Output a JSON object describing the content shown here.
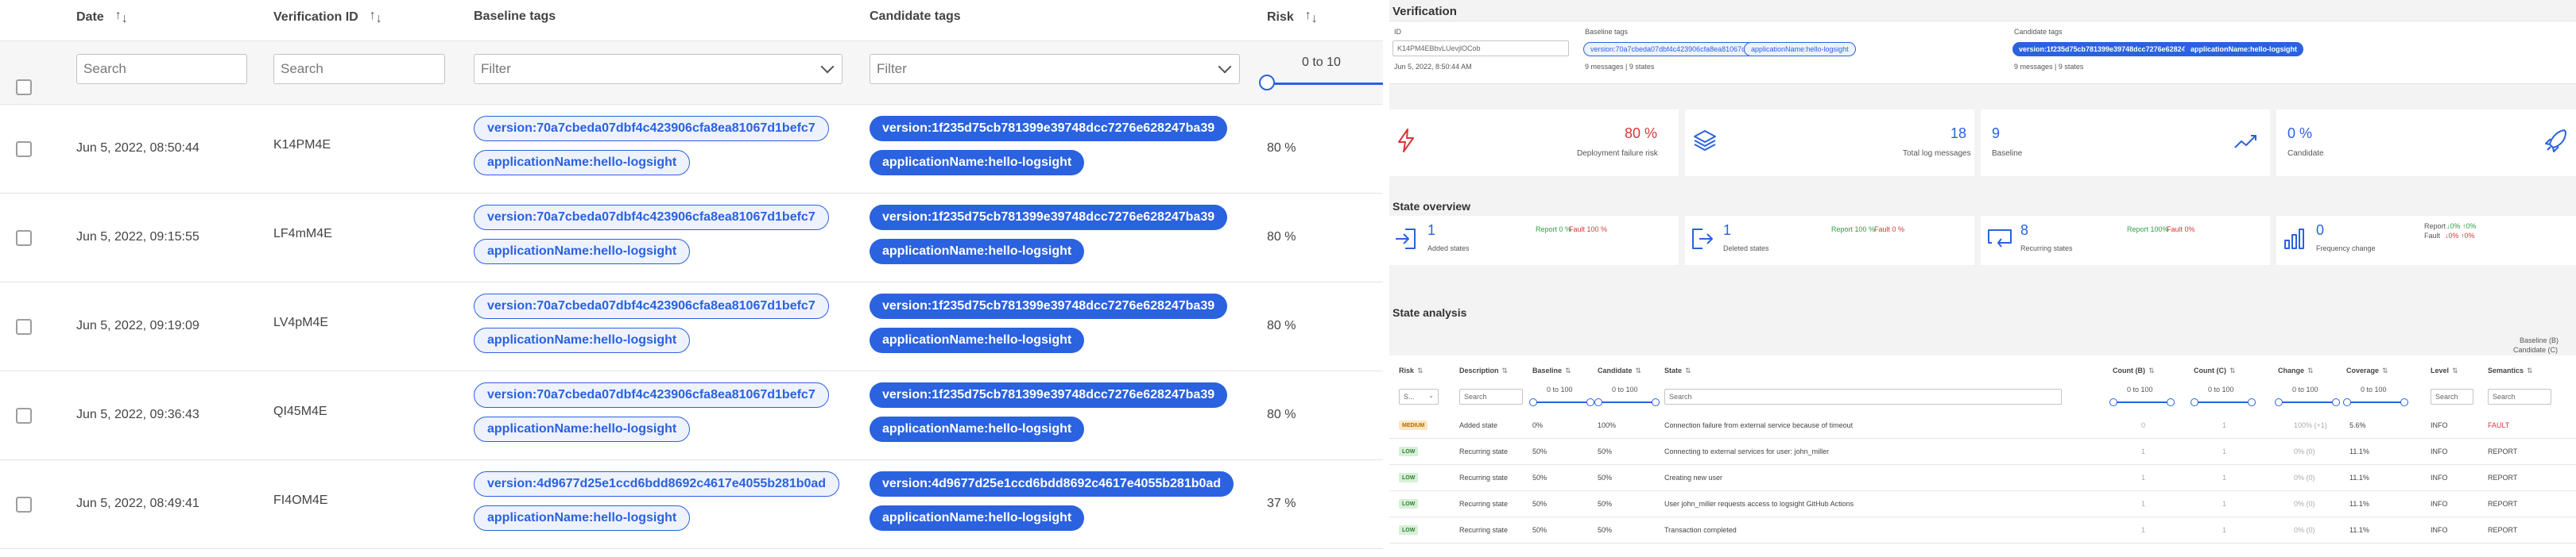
{
  "list": {
    "headers": {
      "date": "Date",
      "verification_id": "Verification ID",
      "baseline_tags": "Baseline tags",
      "candidate_tags": "Candidate tags",
      "risk": "Risk"
    },
    "filters": {
      "date_placeholder": "Search",
      "id_placeholder": "Search",
      "baseline_placeholder": "Filter",
      "candidate_placeholder": "Filter",
      "risk_range": "0 to 10"
    },
    "rows": [
      {
        "date": "Jun 5, 2022, 08:50:44",
        "id": "K14PM4E",
        "baseline": [
          "version:70a7cbeda07dbf4c423906cfa8ea81067d1befc7",
          "applicationName:hello-logsight"
        ],
        "candidate": [
          "version:1f235d75cb781399e39748dcc7276e628247ba39",
          "applicationName:hello-logsight"
        ],
        "risk": "80 %"
      },
      {
        "date": "Jun 5, 2022, 09:15:55",
        "id": "LF4mM4E",
        "baseline": [
          "version:70a7cbeda07dbf4c423906cfa8ea81067d1befc7",
          "applicationName:hello-logsight"
        ],
        "candidate": [
          "version:1f235d75cb781399e39748dcc7276e628247ba39",
          "applicationName:hello-logsight"
        ],
        "risk": "80 %"
      },
      {
        "date": "Jun 5, 2022, 09:19:09",
        "id": "LV4pM4E",
        "baseline": [
          "version:70a7cbeda07dbf4c423906cfa8ea81067d1befc7",
          "applicationName:hello-logsight"
        ],
        "candidate": [
          "version:1f235d75cb781399e39748dcc7276e628247ba39",
          "applicationName:hello-logsight"
        ],
        "risk": "80 %"
      },
      {
        "date": "Jun 5, 2022, 09:36:43",
        "id": "QI45M4E",
        "baseline": [
          "version:70a7cbeda07dbf4c423906cfa8ea81067d1befc7",
          "applicationName:hello-logsight"
        ],
        "candidate": [
          "version:1f235d75cb781399e39748dcc7276e628247ba39",
          "applicationName:hello-logsight"
        ],
        "risk": "80 %"
      },
      {
        "date": "Jun 5, 2022, 08:49:41",
        "id": "FI4OM4E",
        "baseline": [
          "version:4d9677d25e1ccd6bdd8692c4617e4055b281b0ad",
          "applicationName:hello-logsight"
        ],
        "candidate": [
          "version:4d9677d25e1ccd6bdd8692c4617e4055b281b0ad",
          "applicationName:hello-logsight"
        ],
        "risk": "37 %"
      }
    ]
  },
  "detail": {
    "title": "Verification",
    "id_label": "ID",
    "id_value": "K14PM4EBbvLUevjlOCob",
    "timestamp": "Jun 5, 2022, 8:50:44 AM",
    "baseline_tags_label": "Baseline tags",
    "baseline_tags": [
      "version:70a7cbeda07dbf4c423906cfa8ea81067d1befc7",
      "applicationName:hello-logsight"
    ],
    "baseline_counts": "9 messages  |  9 states",
    "candidate_tags_label": "Candidate tags",
    "candidate_tags": [
      "version:1f235d75cb781399e39748dcc7276e628247ba39",
      "applicationName:hello-logsight"
    ],
    "candidate_counts": "9 messages  |  9 states",
    "kpis": {
      "risk_value": "80 %",
      "risk_label": "Deployment failure risk",
      "logs_value": "18",
      "logs_label": "Total log messages",
      "baseline_value": "9",
      "baseline_label": "Baseline",
      "candidate_value": "0 %",
      "candidate_label": "Candidate"
    },
    "state_overview": {
      "title": "State overview",
      "added_value": "1",
      "added_label": "Added states",
      "added_report": "Report 0 %",
      "added_fault": "Fault 100 %",
      "deleted_value": "1",
      "deleted_label": "Deleted states",
      "deleted_report": "Report 100 %",
      "deleted_fault": "Fault 0 %",
      "recurring_value": "8",
      "recurring_label": "Recurring states",
      "recurring_report": "Report 100%",
      "recurring_fault": "Fault 0%",
      "freq_value": "0",
      "freq_label": "Frequency change",
      "freq_report": "Report",
      "freq_report_vals": "↓0%  ↑0%",
      "freq_fault": "Fault",
      "freq_fault_vals": "↓0%  ↑0%"
    },
    "analysis": {
      "title": "State analysis",
      "legend_b": "Baseline (B)",
      "legend_c": "Candidate (C)",
      "headers": {
        "risk": "Risk",
        "description": "Description",
        "baseline": "Baseline",
        "candidate": "Candidate",
        "state": "State",
        "count_b": "Count (B)",
        "count_c": "Count (C)",
        "change": "Change",
        "coverage": "Coverage",
        "level": "Level",
        "semantics": "Semantics"
      },
      "filters": {
        "risk_select": "S...",
        "desc_search": "Search",
        "range": "0 to 100",
        "state_search": "Search",
        "level_search": "Search",
        "sem_search": "Search"
      },
      "rows": [
        {
          "risk": "MEDIUM",
          "desc": "Added state",
          "baseline": "0%",
          "candidate": "100%",
          "state": "Connection failure from external service because of timeout",
          "count_b": "0",
          "count_c": "1",
          "change": "100% (+1)",
          "coverage": "5.6%",
          "level": "INFO",
          "semantics": "FAULT"
        },
        {
          "risk": "LOW",
          "desc": "Recurring state",
          "baseline": "50%",
          "candidate": "50%",
          "state": "Connecting to external services for user: john_miller",
          "count_b": "1",
          "count_c": "1",
          "change": "0% (0)",
          "coverage": "11.1%",
          "level": "INFO",
          "semantics": "REPORT"
        },
        {
          "risk": "LOW",
          "desc": "Recurring state",
          "baseline": "50%",
          "candidate": "50%",
          "state": "Creating new user",
          "count_b": "1",
          "count_c": "1",
          "change": "0% (0)",
          "coverage": "11.1%",
          "level": "INFO",
          "semantics": "REPORT"
        },
        {
          "risk": "LOW",
          "desc": "Recurring state",
          "baseline": "50%",
          "candidate": "50%",
          "state": "User john_miller requests access to logsight GitHub Actions",
          "count_b": "1",
          "count_c": "1",
          "change": "0% (0)",
          "coverage": "11.1%",
          "level": "INFO",
          "semantics": "REPORT"
        },
        {
          "risk": "LOW",
          "desc": "Recurring state",
          "baseline": "50%",
          "candidate": "50%",
          "state": "Transaction completed",
          "count_b": "1",
          "count_c": "1",
          "change": "0% (0)",
          "coverage": "11.1%",
          "level": "INFO",
          "semantics": "REPORT"
        }
      ]
    }
  },
  "colors": {
    "accent": "#2a62e0",
    "danger": "#d93636",
    "success": "#2e9e44"
  }
}
